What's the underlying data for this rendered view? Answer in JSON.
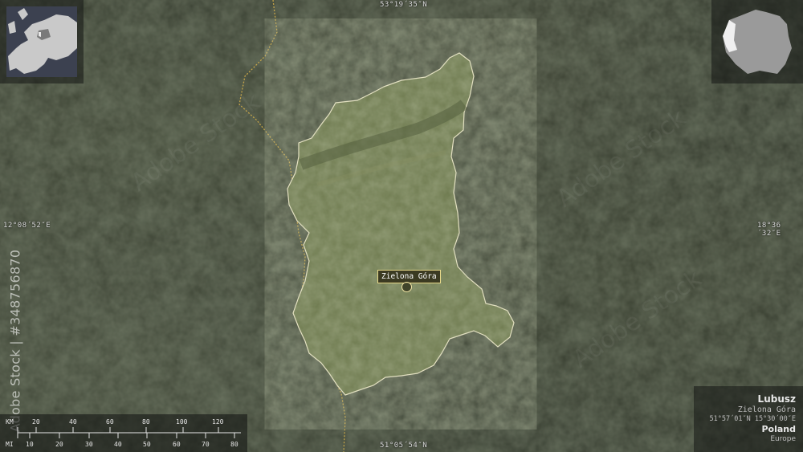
{
  "coords": {
    "top": "53°19´35″N",
    "bottom": "51°05´54″N",
    "left": "12°08´52″E",
    "right": "18°36´32″E"
  },
  "city": {
    "name": "Zielona Góra"
  },
  "info": {
    "region": "Lubusz",
    "capital": "Zielona Góra",
    "center_coords": "51°57´01″N 15°30´00″E",
    "country": "Poland",
    "continent": "Europe"
  },
  "scale": {
    "km_unit": "KM",
    "mi_unit": "MI",
    "km_ticks": [
      "20",
      "40",
      "60",
      "80",
      "100",
      "120"
    ],
    "mi_ticks": [
      "10",
      "20",
      "30",
      "40",
      "50",
      "60",
      "70",
      "80"
    ]
  },
  "watermark": {
    "text": "Adobe Stock | #348756870"
  },
  "colors": {
    "region_fill": "#6f7a52",
    "region_border": "#e9e4c4",
    "border_dotted": "#d8b24a",
    "label_border": "#e8d98a"
  }
}
